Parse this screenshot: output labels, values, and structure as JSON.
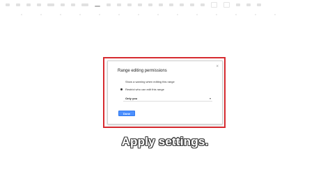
{
  "dialog": {
    "title": "Range editing permissions",
    "close_glyph": "×",
    "option_warning": "Show a warning when editing this range",
    "option_restrict": "Restrict who can edit this range",
    "select_value": "Only you",
    "select_caret": "▾",
    "done_label": "Done"
  },
  "caption": {
    "text": "Apply settings."
  },
  "colors": {
    "highlight": "#d62a2f",
    "done_button": "#4d90fe"
  }
}
